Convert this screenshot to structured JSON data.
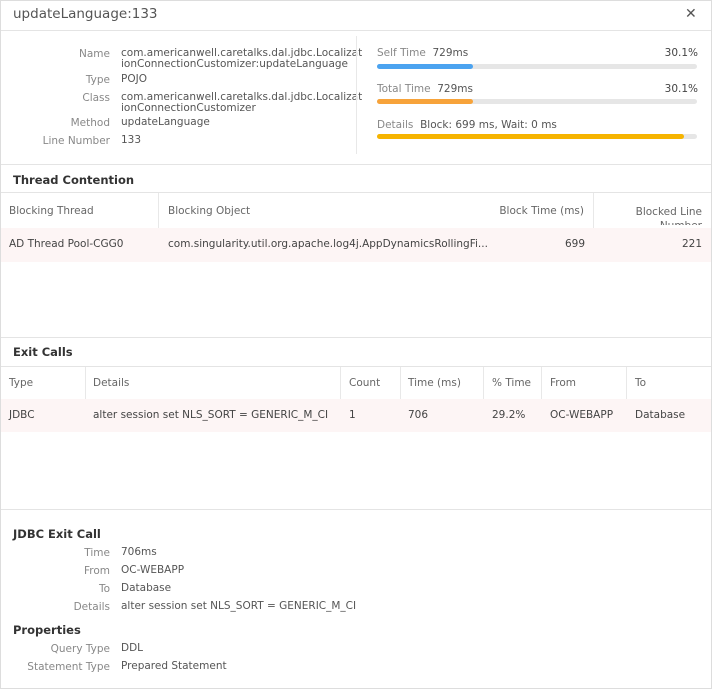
{
  "title": "updateLanguage:133",
  "close_icon": "close-icon",
  "info": [
    {
      "label": "Name",
      "value": "com.americanwell.caretalks.dal.jdbc.Localizat",
      "value2": "ionConnectionCustomizer:updateLanguage"
    },
    {
      "label": "Type",
      "value": "POJO"
    },
    {
      "label": "Class",
      "value": "com.americanwell.caretalks.dal.jdbc.Localizat",
      "value2": "ionConnectionCustomizer"
    },
    {
      "label": "Method",
      "value": "updateLanguage"
    },
    {
      "label": "Line Number",
      "value": "133"
    }
  ],
  "metrics": {
    "self": {
      "label": "Self Time",
      "value": "729ms",
      "percent": "30.1%",
      "fill": 30.1,
      "color": "#4ba3f0"
    },
    "total": {
      "label": "Total Time",
      "value": "729ms",
      "percent": "30.1%",
      "fill": 30.1,
      "color": "#f7a33a"
    },
    "details": {
      "label": "Details",
      "value": "Block: 699 ms, Wait: 0 ms",
      "fill": 96,
      "color": "#f6b400"
    }
  },
  "thread_contention": {
    "title": "Thread Contention",
    "columns": [
      "Blocking Thread",
      "Blocking Object",
      "Block Time (ms)",
      "Blocked Line Number"
    ],
    "rows": [
      [
        "AD Thread Pool-CGG0",
        "com.singularity.util.org.apache.log4j.AppDynamicsRollingFi...",
        "699",
        "221"
      ]
    ]
  },
  "exit_calls": {
    "title": "Exit Calls",
    "columns": [
      "Type",
      "Details",
      "Count",
      "Time (ms)",
      "% Time",
      "From",
      "To"
    ],
    "rows": [
      [
        "JDBC",
        "alter session set NLS_SORT = GENERIC_M_CI",
        "1",
        "706",
        "29.2%",
        "OC-WEBAPP",
        "Database"
      ]
    ]
  },
  "jdbc": {
    "title": "JDBC Exit Call",
    "fields": [
      {
        "label": "Time",
        "value": "706ms"
      },
      {
        "label": "From",
        "value": "OC-WEBAPP"
      },
      {
        "label": "To",
        "value": "Database"
      },
      {
        "label": "Details",
        "value": "alter session set NLS_SORT = GENERIC_M_CI"
      }
    ]
  },
  "properties": {
    "title": "Properties",
    "fields": [
      {
        "label": "Query Type",
        "value": "DDL"
      },
      {
        "label": "Statement Type",
        "value": "Prepared Statement"
      }
    ]
  }
}
